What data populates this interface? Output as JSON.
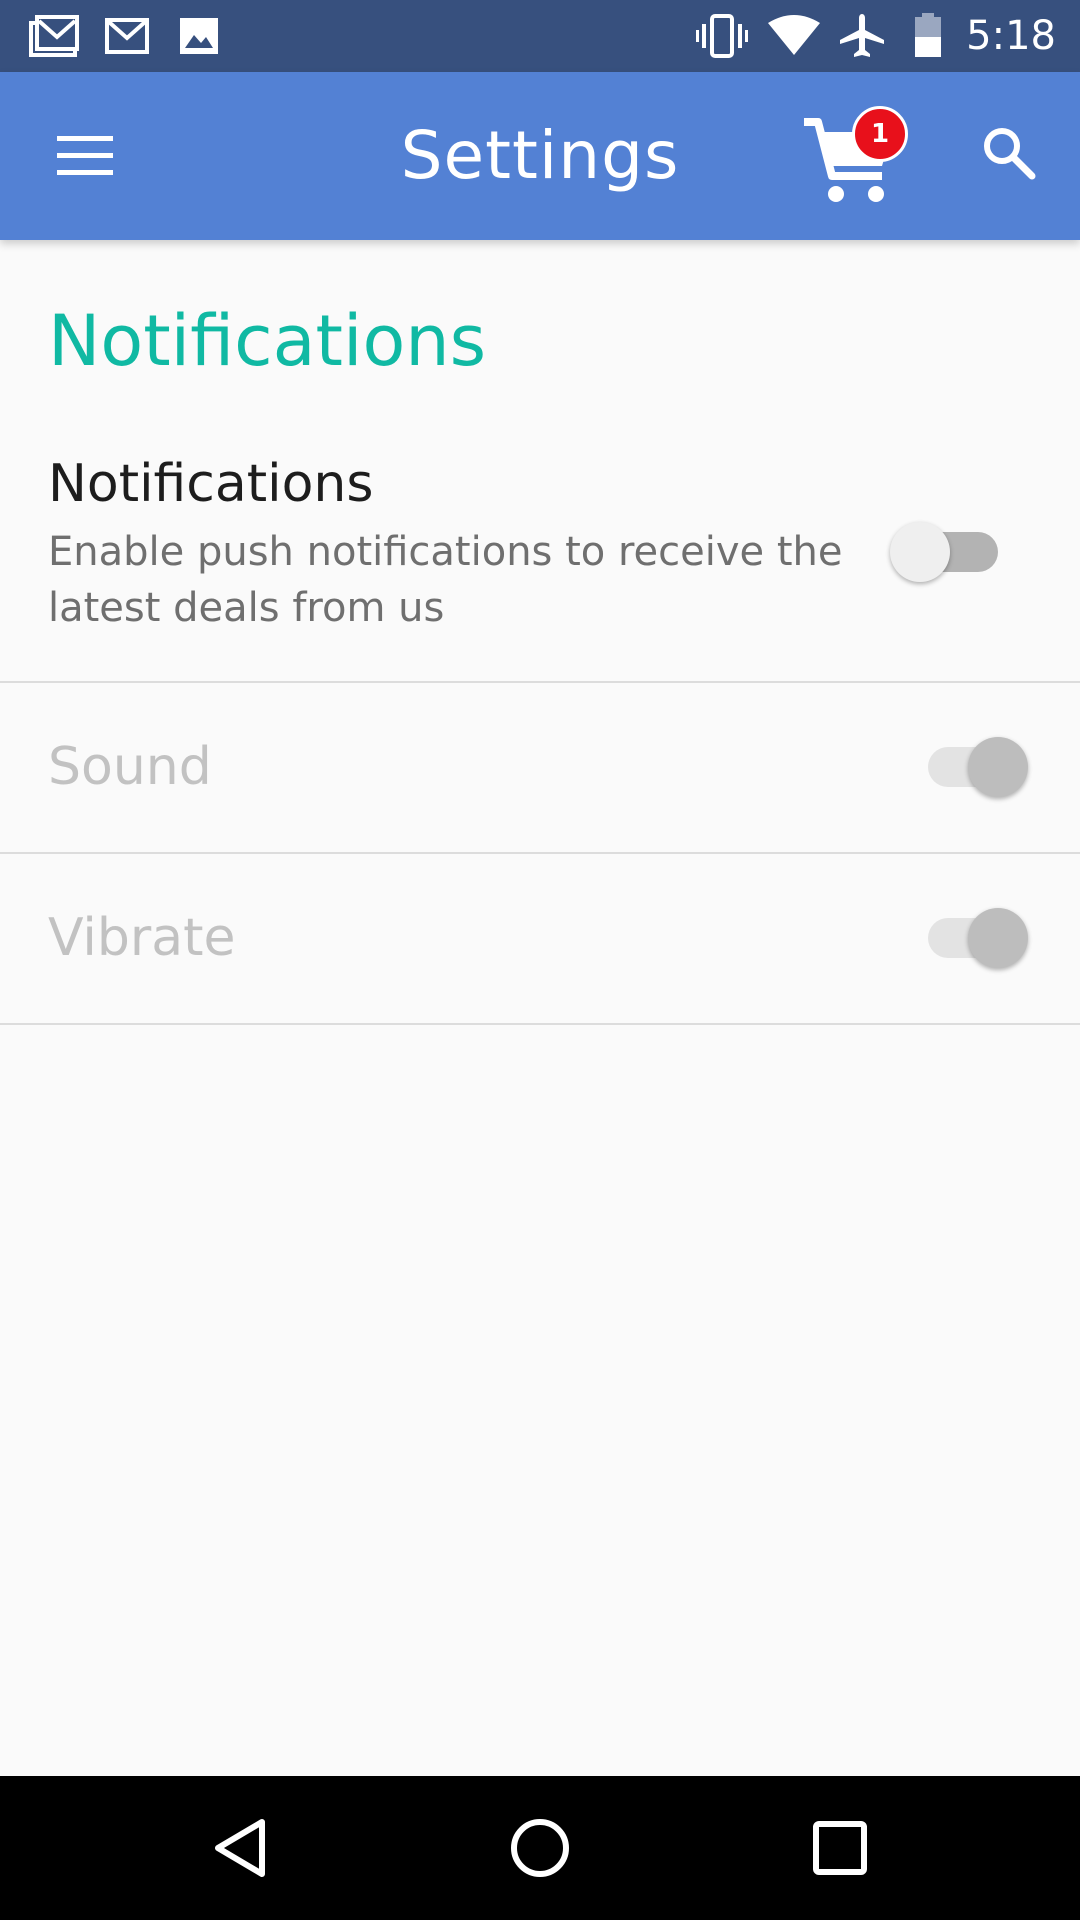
{
  "status_bar": {
    "time": "5:18",
    "icons": [
      "gmail-icon",
      "mail-icon",
      "image-icon",
      "vibrate-icon",
      "wifi-icon",
      "airplane-icon",
      "battery-icon"
    ]
  },
  "app_bar": {
    "title": "Settings",
    "cart_count": "1",
    "icons": [
      "menu-icon",
      "cart-icon",
      "search-icon"
    ]
  },
  "section": {
    "title": "Notifications"
  },
  "settings": [
    {
      "title": "Notifications",
      "description": "Enable push notifications to receive the latest deals from us",
      "toggle_state": "off",
      "enabled": true
    },
    {
      "title": "Sound",
      "toggle_state": "on",
      "enabled": false
    },
    {
      "title": "Vibrate",
      "toggle_state": "on",
      "enabled": false
    }
  ],
  "nav_bar": {
    "icons": [
      "back-icon",
      "home-icon",
      "recents-icon"
    ]
  },
  "colors": {
    "status_bar": "#37507E",
    "app_bar": "#5381D4",
    "accent": "#10B9A3",
    "badge": "#E8101B",
    "background": "#FAFAFA"
  }
}
